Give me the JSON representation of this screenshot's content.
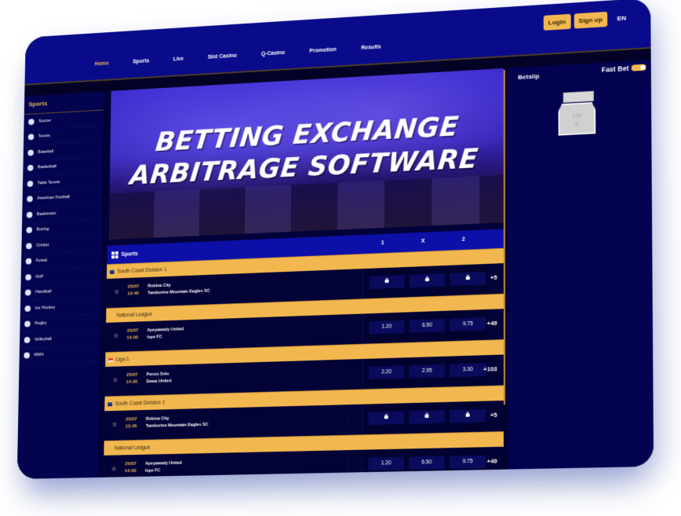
{
  "header": {
    "nav": [
      {
        "label": "Home",
        "active": true
      },
      {
        "label": "Sports",
        "active": false
      },
      {
        "label": "Live",
        "active": false
      },
      {
        "label": "Slot Casino",
        "active": false
      },
      {
        "label": "Q-Casino",
        "active": false
      },
      {
        "label": "Promotion",
        "active": false
      },
      {
        "label": "Results",
        "active": false
      }
    ],
    "login_label": "Login",
    "signup_label": "Sign up",
    "language": "EN"
  },
  "sidebar": {
    "title": "Sports",
    "items": [
      {
        "label": "Soccer",
        "icon": "soccer-icon"
      },
      {
        "label": "Tennis",
        "icon": "tennis-icon"
      },
      {
        "label": "Baseball",
        "icon": "baseball-icon"
      },
      {
        "label": "Basketball",
        "icon": "basketball-icon"
      },
      {
        "label": "Table Tennis",
        "icon": "table-tennis-icon"
      },
      {
        "label": "American Football",
        "icon": "american-football-icon"
      },
      {
        "label": "Badminton",
        "icon": "badminton-icon"
      },
      {
        "label": "Boxing",
        "icon": "boxing-icon"
      },
      {
        "label": "Cricket",
        "icon": "cricket-icon"
      },
      {
        "label": "Futsal",
        "icon": "futsal-icon"
      },
      {
        "label": "Golf",
        "icon": "golf-icon"
      },
      {
        "label": "Handball",
        "icon": "handball-icon"
      },
      {
        "label": "Ice Hockey",
        "icon": "ice-hockey-icon"
      },
      {
        "label": "Rugby",
        "icon": "rugby-icon"
      },
      {
        "label": "Volleyball",
        "icon": "volleyball-icon"
      },
      {
        "label": "MMA",
        "icon": "mma-icon"
      }
    ]
  },
  "banner": {
    "line1": "BETTING EXCHANGE",
    "line2": "ARBITRAGE SOFTWARE"
  },
  "sports_table": {
    "title": "Sports",
    "columns": [
      "1",
      "X",
      "2"
    ],
    "groups": [
      {
        "league": "South Coast Division 1",
        "flag": "au",
        "match": {
          "date": "25/07",
          "time": "13:45",
          "home": "Robina City",
          "away": "Tamborine Mountain Eagles SC",
          "odds": [
            "locked",
            "locked",
            "locked"
          ],
          "more": "+5"
        }
      },
      {
        "league": "National League",
        "flag": "",
        "match": {
          "date": "25/07",
          "time": "14:00",
          "home": "Ayeyawady United",
          "away": "Ispe FC",
          "odds": [
            "1.20",
            "6.50",
            "9.75"
          ],
          "more": "+49"
        }
      },
      {
        "league": "Liga 1",
        "flag": "id",
        "match": {
          "date": "25/07",
          "time": "14:30",
          "home": "Persis Solo",
          "away": "Dewa United",
          "odds": [
            "2.20",
            "2.95",
            "3.30"
          ],
          "more": "+103"
        }
      },
      {
        "league": "South Coast Division 1",
        "flag": "au",
        "match": {
          "date": "25/07",
          "time": "13:45",
          "home": "Robina City",
          "away": "Tamborine Mountain Eagles SC",
          "odds": [
            "locked",
            "locked",
            "locked"
          ],
          "more": "+5"
        }
      },
      {
        "league": "National League",
        "flag": "",
        "match": {
          "date": "25/07",
          "time": "14:00",
          "home": "Ayeyawady United",
          "away": "Ispe FC",
          "odds": [
            "1.20",
            "6.50",
            "9.75"
          ],
          "more": "+49"
        }
      }
    ]
  },
  "betslip": {
    "title": "Betslip",
    "fast_bet_label": "Fast Bet",
    "fast_bet_enabled": true,
    "empty_illustration_time": "2:30"
  },
  "colors": {
    "accent": "#f2b84f",
    "nav_bg": "#0a0b8a",
    "page_bg": "#02024a"
  }
}
